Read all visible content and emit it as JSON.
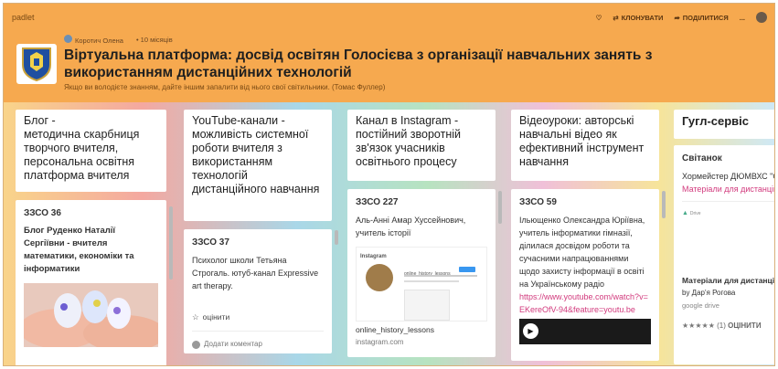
{
  "app": {
    "brand": "padlet"
  },
  "actions": {
    "clone": "КЛОНУВАТИ",
    "share": "ПОДІЛИТИСЯ",
    "more": "..."
  },
  "author": {
    "name": "Коротич Олена",
    "time": "10 місяців"
  },
  "board": {
    "title": "Віртуальна платформа: досвід освітян Голосієва з організації навчальних занять з використанням дистанційних технологій",
    "subtitle": "Якщо ви володієте знанням, дайте іншим запалити від нього свої світильники. (Томас Фуллер)"
  },
  "columns": [
    {
      "title": "Блог -\nметодична скарбниця творчого вчителя, персональна освітня платформа вчителя"
    },
    {
      "title": "YouTube-канали - можливість системної роботи вчителя з використанням технологій дистанційного навчання"
    },
    {
      "title": "Канал в Instagram - постійний зворотній зв'язок учасників освітнього процесу"
    },
    {
      "title": "Відеоуроки: авторські навчальні відео як ефективний інструмент навчання"
    },
    {
      "title": "Гугл-сервіс"
    }
  ],
  "cards": {
    "c1": {
      "head": "ЗЗСО 36",
      "body": "Блог Руденко Наталії Сергіївни - вчителя математики, економіки та інформатики"
    },
    "c2": {
      "head": "ЗЗСО 37",
      "body": "Психолог школи   Тетьяна Строгаль.   ютуб-канал Expressive art therapy.",
      "rate": "оцінити",
      "comment": "Додати коментар"
    },
    "c3": {
      "head": "ЗЗСО 227",
      "body": "Аль-Анні Амар Хуссейнович, учитель історії",
      "insta_user": "online_history_lessons",
      "link_title": "online_history_lessons",
      "link_domain": "instagram.com"
    },
    "c4": {
      "head": "ЗЗСО 59",
      "body": "Ільющенко Олександра Юріївна, учитель інформатики гімназії, ділилася досвідом роботи та сучасними напрацюваннями щодо захисту інформації в освіті на Українському радіо",
      "url": "https://www.youtube.com/watch?v=EKereOfV-94&feature=youtu.be"
    },
    "c5": {
      "head": "Світанок",
      "body": "Хормейстер ДЮМВХС \"Світанок\" Дар'я Рогова",
      "link": "Матеріали для дистанційного навчання.",
      "drive_title": "Матеріали для дистанційного навчання",
      "drive_by": "by Дар'я Рогова",
      "drive_src": "google drive",
      "rating": "(1)",
      "rate": "ОЦІНИТИ"
    }
  },
  "colors": {
    "header": "#f6a94f",
    "accent": "#d23a7d"
  }
}
